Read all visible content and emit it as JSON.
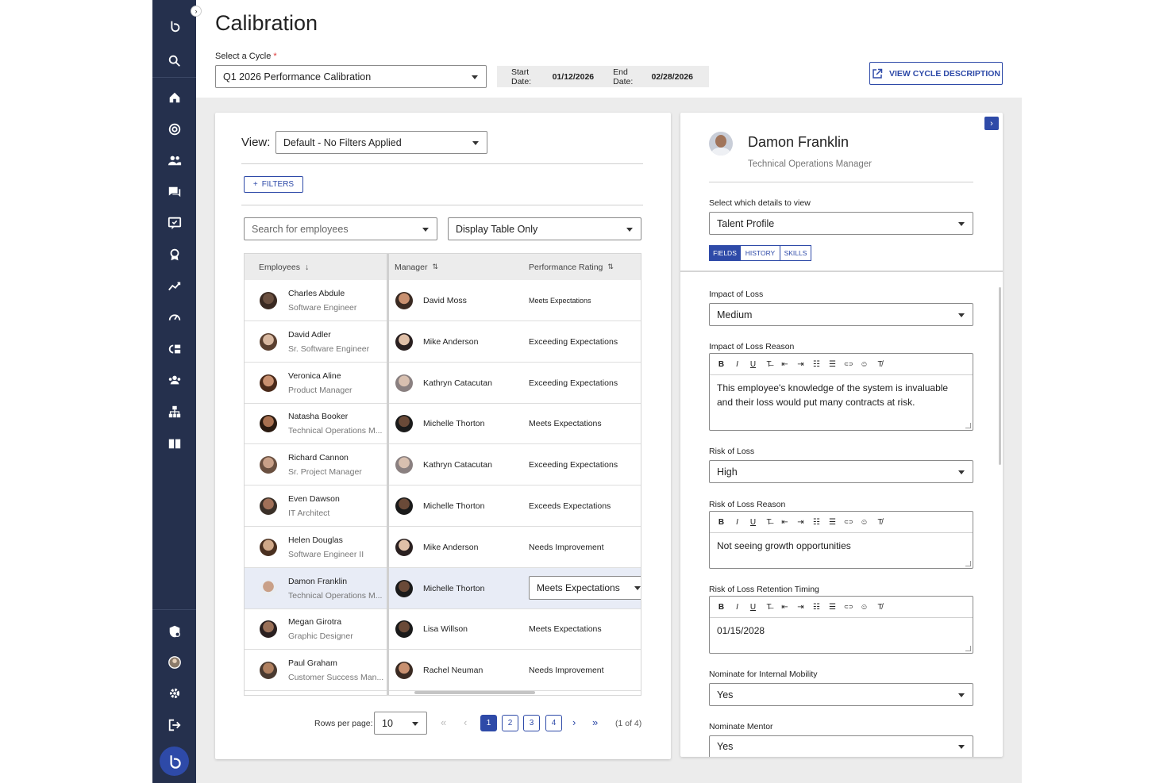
{
  "page": {
    "title": "Calibration"
  },
  "cycle": {
    "label": "Select a Cycle",
    "required_mark": "*",
    "value": "Q1 2026 Performance Calibration",
    "start_label": "Start Date:",
    "start_date": "01/12/2026",
    "end_label": "End Date:",
    "end_date": "02/28/2026",
    "view_description": "VIEW CYCLE DESCRIPTION"
  },
  "left": {
    "view_label": "View:",
    "view_value": "Default - No Filters Applied",
    "filters_label": "FILTERS",
    "search_placeholder": "Search for employees",
    "display_value": "Display Table Only",
    "columns": {
      "employees": "Employees",
      "manager": "Manager",
      "rating": "Performance Rating"
    },
    "rows": [
      {
        "name": "Charles Abdule",
        "title": "Software Engineer",
        "manager": "David Moss",
        "rating": "Meets Expectations"
      },
      {
        "name": "David Adler",
        "title": "Sr. Software Engineer",
        "manager": "Mike Anderson",
        "rating": "Exceeding Expectations"
      },
      {
        "name": "Veronica Aline",
        "title": "Product Manager",
        "manager": "Kathryn Catacutan",
        "rating": "Exceeding Expectations"
      },
      {
        "name": "Natasha Booker",
        "title": "Technical Operations M...",
        "manager": "Michelle Thorton",
        "rating": "Meets Expectations"
      },
      {
        "name": "Richard Cannon",
        "title": "Sr. Project Manager",
        "manager": "Kathryn Catacutan",
        "rating": "Exceeding Expectations"
      },
      {
        "name": "Even Dawson",
        "title": "IT Architect",
        "manager": "Michelle Thorton",
        "rating": "Exceeds Expectations"
      },
      {
        "name": "Helen Douglas",
        "title": "Software Engineer II",
        "manager": "Mike Anderson",
        "rating": "Needs Improvement"
      },
      {
        "name": "Damon Franklin",
        "title": "Technical Operations M...",
        "manager": "Michelle Thorton",
        "rating": "Meets Expectations"
      },
      {
        "name": "Megan Girotra",
        "title": "Graphic Designer",
        "manager": "Lisa Willson",
        "rating": "Meets Expectations"
      },
      {
        "name": "Paul Graham",
        "title": "Customer Success Man...",
        "manager": "Rachel Neuman",
        "rating": "Needs Improvement"
      }
    ],
    "pagination": {
      "rows_per_page_label": "Rows per page:",
      "rows_per_page": "10",
      "pages": [
        "1",
        "2",
        "3",
        "4"
      ],
      "current_page": "1",
      "summary": "(1 of 4)"
    }
  },
  "right": {
    "name": "Damon Franklin",
    "title": "Technical Operations Manager",
    "details_label": "Select which details to view",
    "details_value": "Talent Profile",
    "tabs": [
      "FIELDS",
      "HISTORY",
      "SKILLS"
    ],
    "fields": {
      "impact_label": "Impact of Loss",
      "impact_value": "Medium",
      "impact_reason_label": "Impact of Loss Reason",
      "impact_reason_text": "This employee's knowledge of the system is invaluable and their loss would put many contracts at risk.",
      "risk_label": "Risk of Loss",
      "risk_value": "High",
      "risk_reason_label": "Risk of Loss Reason",
      "risk_reason_text": "Not seeing growth opportunities",
      "retention_label": "Risk of Loss Retention Timing",
      "retention_text": "01/15/2028",
      "mobility_label": "Nominate for Internal Mobility",
      "mobility_value": "Yes",
      "mentor_label": "Nominate Mentor",
      "mentor_value": "Yes"
    }
  },
  "toolbar_glyphs": [
    "B",
    "I",
    "U",
    "T̶",
    "⇤",
    "⇥",
    "☷",
    "☰",
    "⊂⊃",
    "☺",
    "T̸"
  ],
  "icons": {
    "sidebar_top": [
      "logo-icon",
      "search-icon"
    ],
    "sidebar_nav": [
      "home-icon",
      "goals-icon",
      "people-icon",
      "chat-icon",
      "feedback-icon",
      "award-icon",
      "analytics-icon",
      "gauge-icon",
      "toggle-icon",
      "team-icon",
      "org-chart-icon",
      "book-icon"
    ],
    "sidebar_bottom": [
      "security-icon",
      "profile-icon",
      "gear-icon",
      "logout-icon"
    ]
  },
  "colors": {
    "sidebar": "#25304d",
    "accent": "#2e4aa8",
    "selected_row": "#e8ecf6"
  }
}
